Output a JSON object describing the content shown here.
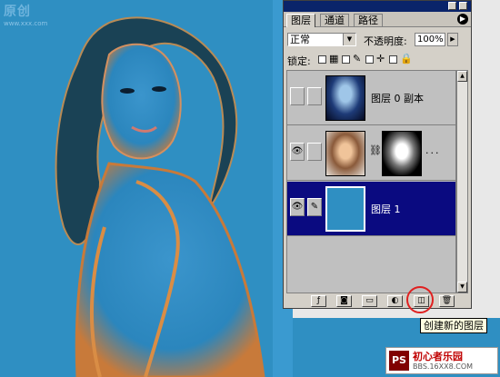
{
  "canvas": {
    "watermark": "原创",
    "watermark_sub": "www.xxx.com"
  },
  "tabs": [
    "图层",
    "通道",
    "路径"
  ],
  "blend_mode": "正常",
  "opacity_label": "不透明度:",
  "opacity_value": "100%",
  "lock_label": "锁定:",
  "layers": [
    {
      "name": "图层 0 副本",
      "visible": false,
      "selected": false
    },
    {
      "name": "",
      "visible": true,
      "selected": false,
      "has_mask": true,
      "dots": "..."
    },
    {
      "name": "图层 1",
      "visible": true,
      "selected": true
    }
  ],
  "tooltip": "创建新的图层",
  "logo": {
    "badge": "PS",
    "brand": "初心者乐园",
    "url": "BBS.16XX8.COM"
  },
  "colors": {
    "canvas_blue": "#2f8fc2",
    "selection": "#0a0a80",
    "highlight": "#e02020"
  }
}
